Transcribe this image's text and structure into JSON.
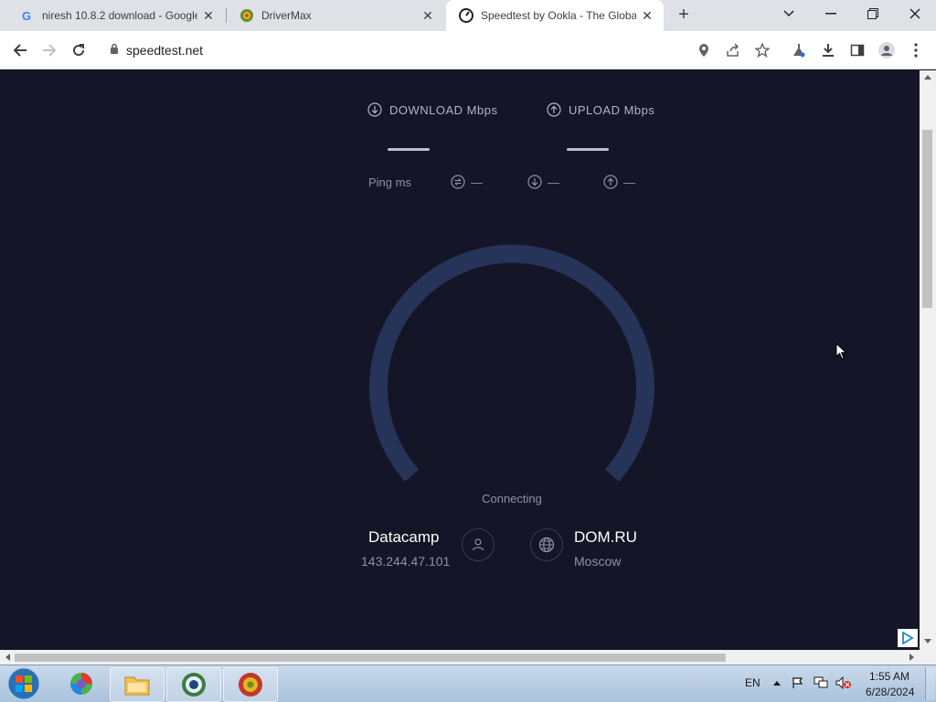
{
  "browser": {
    "tabs": [
      {
        "title": "niresh 10.8.2 download - Google",
        "favicon": "google-icon",
        "active": false
      },
      {
        "title": "DriverMax",
        "favicon": "drivermax-icon",
        "active": false
      },
      {
        "title": "Speedtest by Ookla - The Globa",
        "favicon": "speedtest-icon",
        "active": true
      }
    ],
    "new_tab_label": "+",
    "url": "speedtest.net"
  },
  "speedtest": {
    "download_label": "DOWNLOAD Mbps",
    "upload_label": "UPLOAD Mbps",
    "ping_label": "Ping ms",
    "ping_value": "—",
    "download_ping_value": "—",
    "upload_ping_value": "—",
    "status": "Connecting",
    "host_name": "Datacamp",
    "host_ip": "143.244.47.101",
    "isp_name": "DOM.RU",
    "isp_location": "Moscow",
    "gauge_color": "#26345a"
  },
  "taskbar": {
    "language": "EN",
    "time": "1:55 AM",
    "date": "6/28/2024"
  }
}
